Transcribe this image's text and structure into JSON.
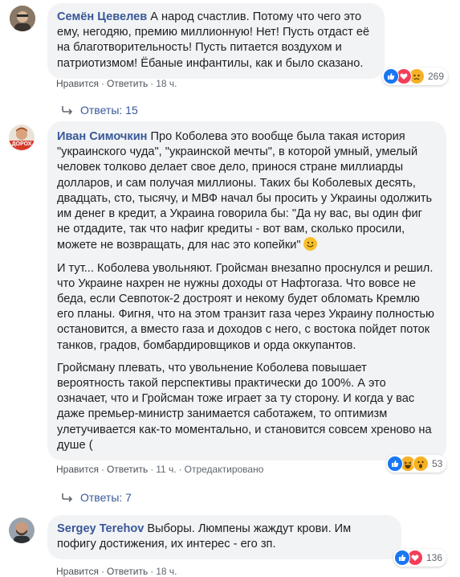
{
  "comments": [
    {
      "author": "Семён Цевелев",
      "paragraphs": [
        "А народ счастлив. Потому что чего это ему, негодяю, премию миллионную! Нет! Пусть отдаст её на благотворительность! Пусть питается воздухом и патриотизмом! Ёбаные инфантилы, как и было сказано."
      ],
      "like_label": "Нравится",
      "reply_label": "Ответить",
      "time": "18 ч.",
      "reactions": [
        "like",
        "love",
        "sad"
      ],
      "reaction_count": "269",
      "replies_label": "Ответы: 15"
    },
    {
      "author": "Иван Симочкин",
      "avatar_text": "ДОРОХ",
      "paragraphs": [
        "Про Коболева это вообще была такая история \"украинского чуда\", \"украинской мечты\", в которой умный, умелый человек толково делает свое дело, принося стране миллиарды долларов, и сам получая миллионы. Таких бы Коболевых десять, двадцать, сто, тысячу, и МВФ начал бы просить у Украины одолжить им денег в кредит, а Украина говорила бы: \"Да ну вас, вы один фиг не отдадите, так что нафиг кредиты - вот вам, сколько просили, можете не возвращать, для нас это копейки\"",
        "И тут... Коболева увольняют. Гройсман внезапно проснулся и решил. что Украине нахрен не нужны доходы от Нафтогаза. Что вовсе не беда, если Севпоток-2 достроят и некому будет обломать Кремлю его планы. Фигня, что на этом транзит газа через Украину полностью остановится, а вместо газа и доходов с него, с востока пойдет поток танков, градов, бомбардировщиков и орда оккупантов.",
        "Гройсману плевать, что увольнение Коболева повышает вероятность такой перспективы практически до 100%. А это означает, что и Гройсман тоже играет за ту сторону. И когда у вас даже премьер-министр занимается саботажем, то оптимизм улетучивается как-то моментально, и становится совсем хреново на душе ("
      ],
      "like_label": "Нравится",
      "reply_label": "Ответить",
      "time": "11 ч.",
      "edited_label": "Отредактировано",
      "reactions": [
        "like",
        "haha",
        "wow"
      ],
      "reaction_count": "53",
      "replies_label": "Ответы: 7"
    },
    {
      "author": "Sergey Terehov",
      "paragraphs": [
        "Выборы. Люмпены жаждут крови. Им пофигу достижения, их интерес - его зп."
      ],
      "like_label": "Нравится",
      "reply_label": "Ответить",
      "time": "18 ч.",
      "reactions": [
        "like",
        "love"
      ],
      "reaction_count": "136"
    }
  ],
  "colors": {
    "bubble": "#f2f3f5",
    "author": "#385898",
    "meta": "#606770",
    "like": "#1877f2",
    "love": "#f33e58",
    "emoji": "#f7b125"
  }
}
